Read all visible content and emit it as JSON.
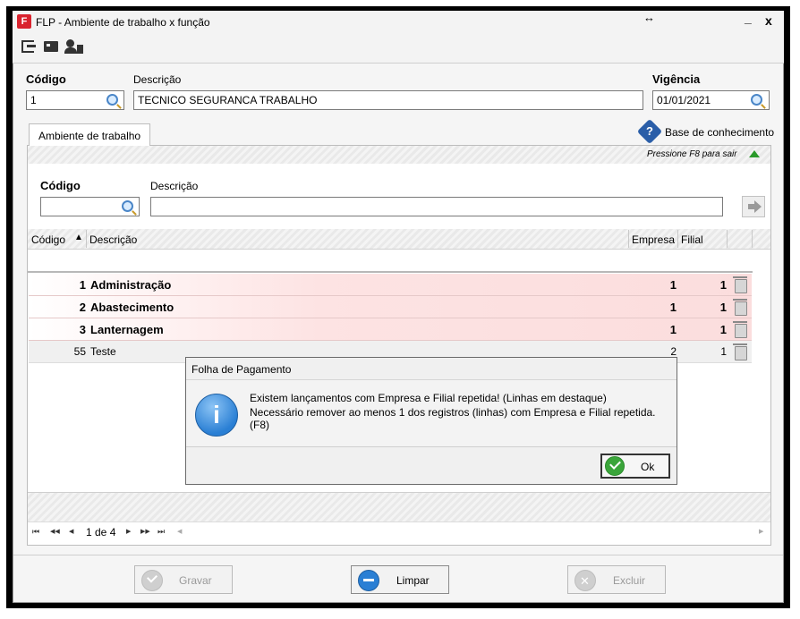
{
  "window": {
    "title": "FLP - Ambiente de trabalho x função",
    "resize_glyph": "↔",
    "minimize_glyph": "_",
    "close_glyph": "x"
  },
  "toolbar": {
    "icons": [
      "exit-icon",
      "cashier-icon",
      "users-icon"
    ]
  },
  "header": {
    "codigo_label": "Código",
    "codigo_value": "1",
    "descricao_label": "Descrição",
    "descricao_value": "TECNICO SEGURANCA TRABALHO",
    "vigencia_label": "Vigência",
    "vigencia_value": "01/01/2021"
  },
  "tab": {
    "label": "Ambiente de trabalho"
  },
  "knowledge_base": {
    "label": "Base de conhecimento"
  },
  "hint": {
    "text": "Pressione F8 para sair"
  },
  "filter": {
    "codigo_label": "Código",
    "descricao_label": "Descrição",
    "codigo_value": "",
    "descricao_value": ""
  },
  "grid": {
    "headers": {
      "codigo": "Código",
      "descricao": "Descrição",
      "empresa": "Empresa",
      "filial": "Filial"
    },
    "sort_glyph": "▲",
    "rows": [
      {
        "codigo": "1",
        "descricao": "Administração",
        "empresa": "1",
        "filial": "1"
      },
      {
        "codigo": "2",
        "descricao": "Abastecimento",
        "empresa": "1",
        "filial": "1"
      },
      {
        "codigo": "3",
        "descricao": "Lanternagem",
        "empresa": "1",
        "filial": "1"
      },
      {
        "codigo": "55",
        "descricao": "Teste",
        "empresa": "2",
        "filial": "1"
      }
    ]
  },
  "pager": {
    "text": "1 de 4",
    "first": "⏮",
    "prev_page": "◀◀",
    "prev": "◀",
    "next": "▶",
    "next_page": "▶▶",
    "last": "⏭"
  },
  "dialog": {
    "title": "Folha de Pagamento",
    "line1": "Existem lançamentos com Empresa e Filial repetida! (Linhas em destaque)",
    "line2": "Necessário remover ao menos 1 dos registros (linhas) com Empresa e Filial repetida. (F8)",
    "ok_label": "Ok",
    "info_glyph": "i"
  },
  "footer": {
    "gravar": "Gravar",
    "limpar": "Limpar",
    "excluir": "Excluir"
  },
  "colors": {
    "accent_red": "#e0232e",
    "duplicate_row": "#fbdddd",
    "ok_green": "#3aa53a",
    "info_blue": "#2a7fd4"
  }
}
